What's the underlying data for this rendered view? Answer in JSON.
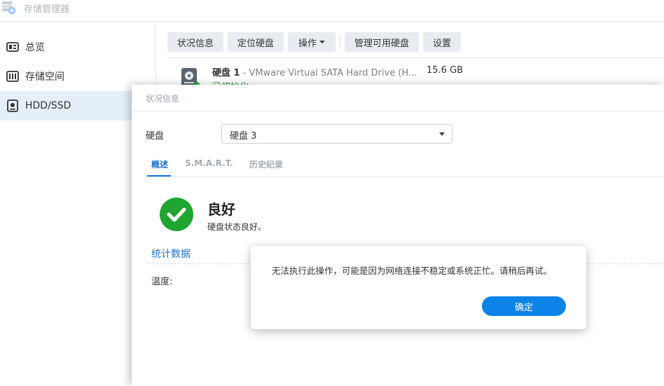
{
  "app": {
    "title": "存储管理器"
  },
  "sidebar": {
    "items": [
      {
        "label": "总览",
        "icon": "overview-icon"
      },
      {
        "label": "存储空间",
        "icon": "storage-pool-icon"
      },
      {
        "label": "HDD/SSD",
        "icon": "hdd-icon"
      }
    ],
    "active_index": 2
  },
  "toolbar": {
    "status_label": "状况信息",
    "locate_label": "定位硬盘",
    "action_label": "操作",
    "manage_label": "管理可用硬盘",
    "settings_label": "设置"
  },
  "disk_list": [
    {
      "name": "硬盘 1",
      "model": " - VMware Virtual SATA Hard Drive (H...",
      "size": "15.6 GB",
      "status": "已初始化"
    }
  ],
  "status_dialog": {
    "title": "状况信息",
    "disk_field_label": "硬盘",
    "selected_disk": "硬盘 3",
    "tabs": [
      "概述",
      "S.M.A.R.T.",
      "历史纪录"
    ],
    "active_tab": 0,
    "health_title": "良好",
    "health_desc": "硬盘状态良好。",
    "stats_title": "统计数据",
    "temperature_label": "温度:"
  },
  "alert": {
    "message": "无法执行此操作，可能是因为网络连接不稳定或系统正忙。请稍后再试。",
    "ok_label": "确定"
  },
  "colors": {
    "accent": "#0b83e8",
    "tab_active": "#1a73c8",
    "good": "#1fa530",
    "sidebar_active": "#e4eff9"
  }
}
